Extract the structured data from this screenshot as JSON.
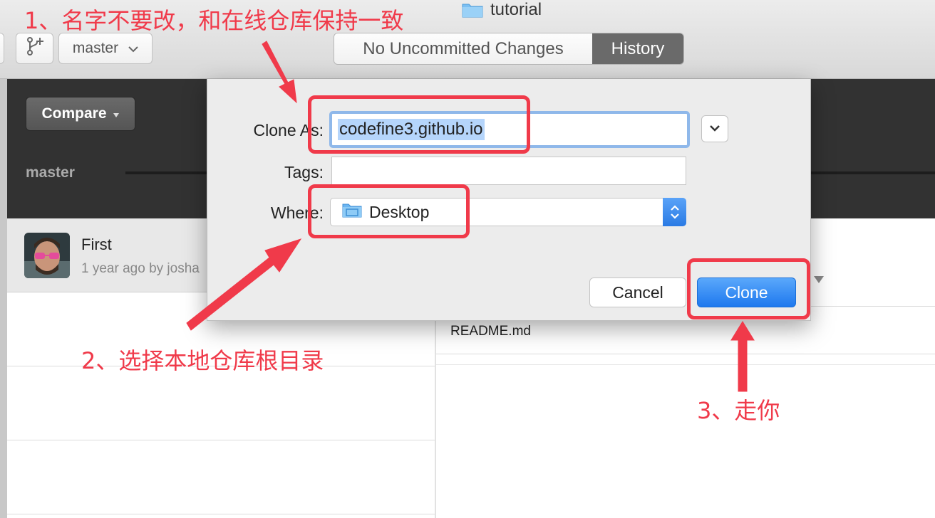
{
  "window": {
    "folder_title": "tutorial"
  },
  "toolbar": {
    "branch_name": "master",
    "segment_uncommitted": "No Uncommitted Changes",
    "segment_history": "History"
  },
  "sidebar": {
    "compare_label": "Compare",
    "branch_label": "master"
  },
  "commit": {
    "title": "First",
    "meta": "1 year ago by josha"
  },
  "files": {
    "readme": "README.md"
  },
  "dialog": {
    "clone_as_label": "Clone As:",
    "clone_as_value": "codefine3.github.io",
    "tags_label": "Tags:",
    "tags_value": "",
    "where_label": "Where:",
    "where_value": "Desktop",
    "cancel_label": "Cancel",
    "clone_label": "Clone"
  },
  "annotations": {
    "step1": "1、名字不要改，和在线仓库保持一致",
    "step2": "2、选择本地仓库根目录",
    "step3": "3、走你"
  },
  "colors": {
    "annotation": "#f03a4a",
    "accent": "#2a7ae4"
  }
}
